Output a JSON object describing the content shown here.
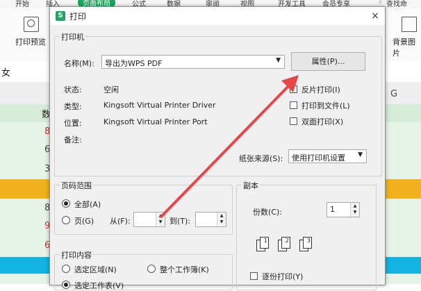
{
  "background": {
    "tabs": [
      "开始",
      "插入",
      "页面布局",
      "公式",
      "数据",
      "审阅",
      "视图",
      "开发工具",
      "会员专享"
    ],
    "active_tab_index": 2,
    "ribbon_left_label": "打印预览",
    "ribbon_right_label": "背景图片",
    "right_corner_text": "查找命",
    "name_box_text": "女",
    "column_g": "G",
    "column_partial": "数",
    "cell_values": [
      "8",
      "6",
      "3",
      "8",
      "9",
      "6"
    ]
  },
  "dialog": {
    "title": "打印",
    "close": "×",
    "printer": {
      "group_title": "打印机",
      "name_label": "名称(M):",
      "name_value": "导出为WPS PDF",
      "properties_button": "属性(P)...",
      "status_label": "状态:",
      "status_value": "空闲",
      "type_label": "类型:",
      "type_value": "Kingsoft Virtual Printer Driver",
      "location_label": "位置:",
      "location_value": "Kingsoft Virtual Printer Port",
      "comment_label": "备注:",
      "reverse_print": "反片打印(I)",
      "print_to_file": "打印到文件(L)",
      "duplex_print": "双面打印(X)",
      "paper_source_label": "纸张来源(S):",
      "paper_source_value": "使用打印机设置"
    },
    "page_range": {
      "group_title": "页码范围",
      "all": "全部(A)",
      "pages": "页(G)",
      "from_label": "从(F):",
      "to_label": "到(T):",
      "from_value": "",
      "to_value": ""
    },
    "copies": {
      "group_title": "副本",
      "count_label": "份数(C):",
      "count_value": "1",
      "collate": "逐份打印(Y)"
    },
    "print_content": {
      "group_title": "打印内容",
      "selection": "选定区域(N)",
      "whole_workbook": "整个工作簿(K)",
      "active_sheet": "选定工作表(V)"
    }
  },
  "annotation": {
    "arrow_color": "#e8474a"
  }
}
